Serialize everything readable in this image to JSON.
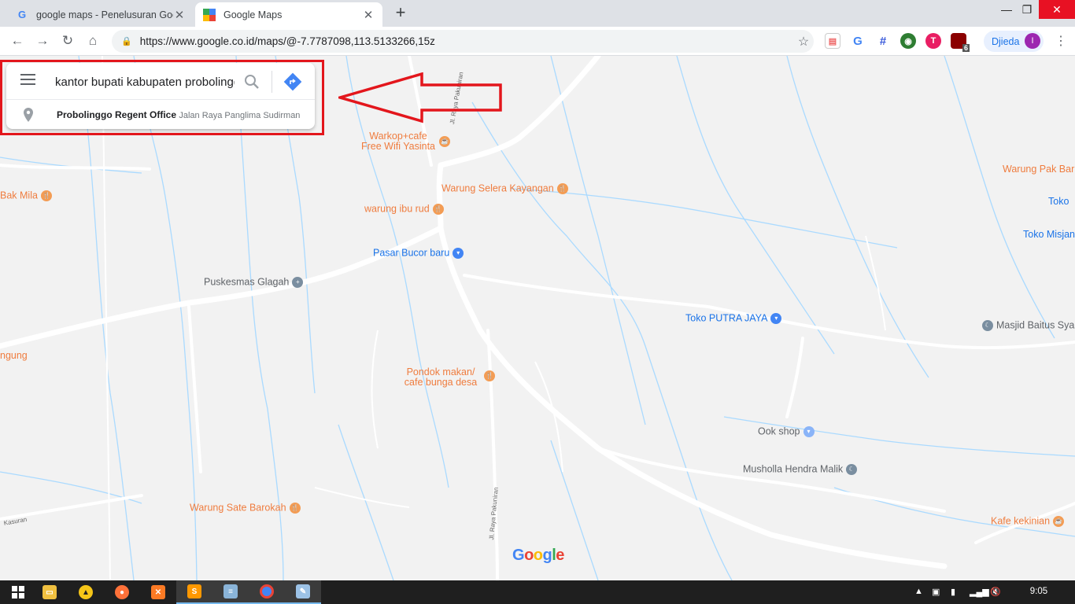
{
  "browser": {
    "tabs": [
      {
        "title": "google maps - Penelusuran Goog",
        "favicon": "google-g-icon",
        "active": false
      },
      {
        "title": "Google Maps",
        "favicon": "google-maps-icon",
        "active": true
      }
    ],
    "new_tab_symbol": "+",
    "url": "https://www.google.co.id/maps/@-7.7787098,113.5133266,15z",
    "profile_name": "Djieda",
    "profile_initial": "I",
    "extension_badge": "6"
  },
  "search": {
    "query": "kantor bupati kabupaten probolinggo",
    "suggestion_name": "Probolinggo Regent Office",
    "suggestion_address": "Jalan Raya Panglima Sudirman"
  },
  "map": {
    "pois": [
      {
        "label": "Warkop+cafe\nFree Wifi Yasinta",
        "kind": "food"
      },
      {
        "label": "Warung Selera Kayangan",
        "kind": "food"
      },
      {
        "label": "warung ibu rud",
        "kind": "food"
      },
      {
        "label": "Pasar Bucor baru",
        "kind": "shop"
      },
      {
        "label": "Puskesmas Glagah",
        "kind": "health"
      },
      {
        "label": "Toko PUTRA JAYA",
        "kind": "shop"
      },
      {
        "label": "Masjid Baitus Sya",
        "kind": "worship"
      },
      {
        "label": "Pondok makan/\ncafe bunga desa",
        "kind": "food"
      },
      {
        "label": "Ook shop",
        "kind": "shop"
      },
      {
        "label": "Musholla Hendra Malik",
        "kind": "worship"
      },
      {
        "label": "Warung Sate Barokah",
        "kind": "food"
      },
      {
        "label": "Kafe kekinian",
        "kind": "food"
      },
      {
        "label": "Bak Mila",
        "kind": "food"
      },
      {
        "label": "Warung Pak Bar",
        "kind": "food"
      },
      {
        "label": "Toko",
        "kind": "shop"
      },
      {
        "label": "Toko Misjan",
        "kind": "shop"
      },
      {
        "label": "ngung",
        "kind": "place"
      }
    ],
    "road_labels": [
      "Jl. Raya Pakuniran",
      "Jl. Raya Pakuniran",
      "Kasuran"
    ],
    "logo": "Google"
  },
  "taskbar": {
    "clock": "9:05"
  },
  "colors": {
    "annotation_red": "#e3161c",
    "map_bg": "#f2f2f2",
    "water": "#aadaff",
    "poi_food": "#ef7c3e",
    "poi_shop": "#1a73e8"
  }
}
